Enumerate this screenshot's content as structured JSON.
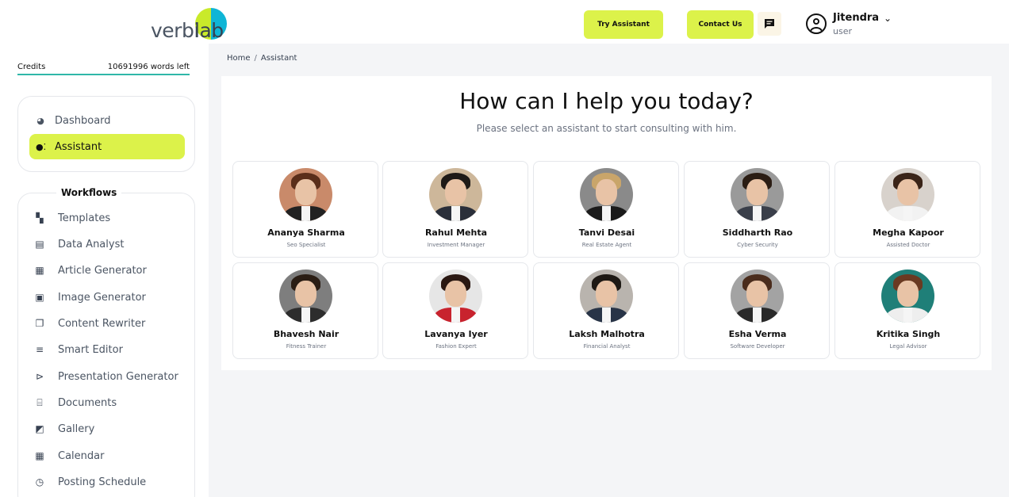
{
  "header": {
    "logo_text": "verbi",
    "logo_text_accent": "lab",
    "try_assistant_label": "Try Assistant",
    "contact_us_label": "Contact Us",
    "user": {
      "name": "Jitendra",
      "role": "user"
    }
  },
  "sidebar": {
    "credits_label": "Credits",
    "credits_value": "10691996 words left",
    "nav": [
      {
        "label": "Dashboard",
        "icon": "pie-chart-icon",
        "active": false
      },
      {
        "label": "Assistant",
        "icon": "assistant-icon",
        "active": true
      }
    ],
    "workflows_title": "Workflows",
    "workflows": [
      {
        "label": "Templates",
        "icon": "dashboard-grid-icon"
      },
      {
        "label": "Data Analyst",
        "icon": "bar-chart-icon"
      },
      {
        "label": "Article Generator",
        "icon": "document-icon"
      },
      {
        "label": "Image Generator",
        "icon": "image-icon"
      },
      {
        "label": "Content Rewriter",
        "icon": "copy-icon"
      },
      {
        "label": "Smart Editor",
        "icon": "edit-lines-icon"
      },
      {
        "label": "Presentation Generator",
        "icon": "play-box-icon"
      },
      {
        "label": "Documents",
        "icon": "documents-icon"
      },
      {
        "label": "Gallery",
        "icon": "gallery-icon"
      },
      {
        "label": "Calendar",
        "icon": "calendar-icon"
      },
      {
        "label": "Posting Schedule",
        "icon": "clock-icon"
      }
    ]
  },
  "main": {
    "breadcrumb": {
      "home": "Home",
      "separator": "/",
      "current": "Assistant"
    },
    "title": "How can I help you today?",
    "subtitle": "Please select an assistant to start consulting with him.",
    "assistants": [
      {
        "name": "Ananya Sharma",
        "role": "Seo Specialist",
        "bg": "#c98a6a",
        "hair": "#5a2e1a",
        "suit": "#222222"
      },
      {
        "name": "Rahul Mehta",
        "role": "Investment Manager",
        "bg": "#cdb79a",
        "hair": "#1e1a17",
        "suit": "#2a2f3a"
      },
      {
        "name": "Tanvi Desai",
        "role": "Real Estate Agent",
        "bg": "#8a8a8a",
        "hair": "#c9a56a",
        "suit": "#1b1b1b"
      },
      {
        "name": "Siddharth Rao",
        "role": "Cyber Security",
        "bg": "#9a9a9a",
        "hair": "#2b1d14",
        "suit": "#3a3f4a"
      },
      {
        "name": "Megha Kapoor",
        "role": "Assisted Doctor",
        "bg": "#d8d2cc",
        "hair": "#3a2418",
        "suit": "#f2f2f2"
      },
      {
        "name": "Bhavesh Nair",
        "role": "Fitness Trainer",
        "bg": "#7e7e7e",
        "hair": "#2a1d14",
        "suit": "#2d2d2d"
      },
      {
        "name": "Lavanya Iyer",
        "role": "Fashion Expert",
        "bg": "#e6e6e6",
        "hair": "#2a1812",
        "suit": "#c8232e"
      },
      {
        "name": "Laksh Malhotra",
        "role": "Financial Analyst",
        "bg": "#b9b4ae",
        "hair": "#1e1914",
        "suit": "#283447"
      },
      {
        "name": "Esha Verma",
        "role": "Software Developer",
        "bg": "#a3a3a3",
        "hair": "#4a2c1c",
        "suit": "#2a2a2a"
      },
      {
        "name": "Kritika Singh",
        "role": "Legal Advisor",
        "bg": "#1f7f78",
        "hair": "#6a3a22",
        "suit": "#eeeeee"
      }
    ]
  },
  "colors": {
    "accent": "#dcf24a",
    "credits_underline": "#2fb7a8",
    "logo_teal": "#0fb5d6",
    "logo_lime": "#c9ea2a"
  }
}
